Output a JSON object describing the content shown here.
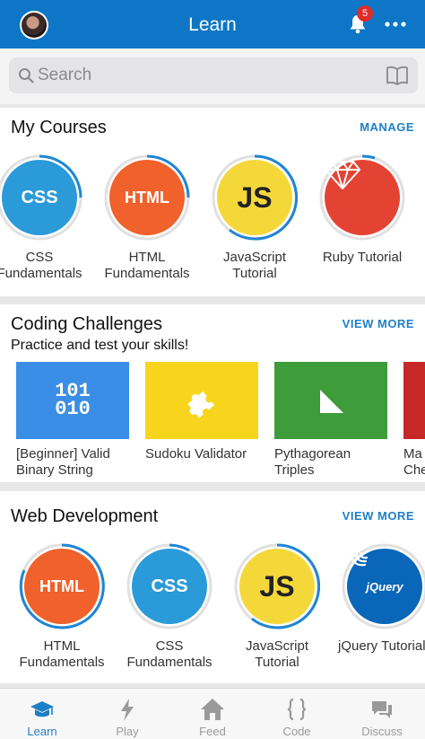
{
  "header": {
    "title": "Learn",
    "notification_count": "5"
  },
  "search": {
    "placeholder": "Search"
  },
  "my_courses": {
    "title": "My Courses",
    "link": "MANAGE",
    "items": [
      {
        "icon_text": "CSS",
        "label": "CSS Fundamentals",
        "color": "#2b9ad8"
      },
      {
        "icon_text": "HTML",
        "label": "HTML Fundamentals",
        "color": "#f0612b"
      },
      {
        "icon_text": "JS",
        "label": "JavaScript Tutorial",
        "color": "#f4d83a"
      },
      {
        "icon_text": "",
        "label": "Ruby Tutorial",
        "color": "#e44333"
      }
    ]
  },
  "challenges": {
    "title": "Coding Challenges",
    "link": "VIEW MORE",
    "subtitle": "Practice and test your skills!",
    "items": [
      {
        "icon_text": "101\n010",
        "label": "[Beginner] Valid Binary String",
        "color": "#3a8ee6"
      },
      {
        "icon_text": "",
        "label": "Sudoku Validator",
        "color": "#f7d51d"
      },
      {
        "icon_text": "",
        "label": "Pythagorean Triples",
        "color": "#3e9c3a"
      },
      {
        "icon_text": "",
        "label": "Ma Che",
        "color": "#c62828"
      }
    ]
  },
  "web_dev": {
    "title": "Web Development",
    "link": "VIEW MORE",
    "items": [
      {
        "icon_text": "HTML",
        "label": "HTML Fundamentals",
        "color": "#f0612b"
      },
      {
        "icon_text": "CSS",
        "label": "CSS Fundamentals",
        "color": "#2b9ad8"
      },
      {
        "icon_text": "JS",
        "label": "JavaScript Tutorial",
        "color": "#f4d83a"
      },
      {
        "icon_text": "jQuery",
        "label": "jQuery Tutorial",
        "color": "#0a66b8"
      }
    ]
  },
  "tabs": [
    {
      "label": "Learn",
      "icon": "graduation-cap-icon",
      "active": true
    },
    {
      "label": "Play",
      "icon": "lightning-icon",
      "active": false
    },
    {
      "label": "Feed",
      "icon": "house-icon",
      "active": false
    },
    {
      "label": "Code",
      "icon": "braces-icon",
      "active": false
    },
    {
      "label": "Discuss",
      "icon": "chat-bubbles-icon",
      "active": false
    }
  ],
  "colors": {
    "brand_blue": "#0d76c6",
    "link_blue": "#1e7fc6",
    "progress_ring": "#1f86d4",
    "badge_red": "#e02b2b"
  }
}
